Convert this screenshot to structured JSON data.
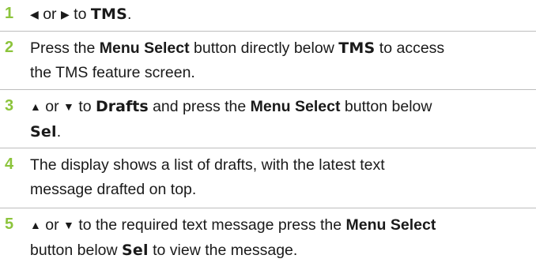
{
  "steps": [
    {
      "number": "1",
      "left_icon": "◀",
      "or": "or",
      "right_icon": "▶",
      "to": "to",
      "target": "TMS",
      "end": "."
    },
    {
      "number": "2",
      "pre": "Press the",
      "button": "Menu Select",
      "mid": "button directly below",
      "target": "TMS",
      "post1": "to access",
      "post2": "the TMS feature screen."
    },
    {
      "number": "3",
      "up_icon": "▲",
      "or": "or",
      "down_icon": "▼",
      "to": "to",
      "target": "Drafts",
      "mid": "and press the",
      "button": "Menu Select",
      "post": "button below",
      "softkey": "Sel",
      "end": "."
    },
    {
      "number": "4",
      "line1": "The display shows a list of drafts, with the latest text",
      "line2": "message drafted on top."
    },
    {
      "number": "5",
      "up_icon": "▲",
      "or": "or",
      "down_icon": "▼",
      "mid": "to the required text message press the",
      "button": "Menu Select",
      "pre2": "button below",
      "softkey": "Sel",
      "post2": "to view the message."
    }
  ]
}
